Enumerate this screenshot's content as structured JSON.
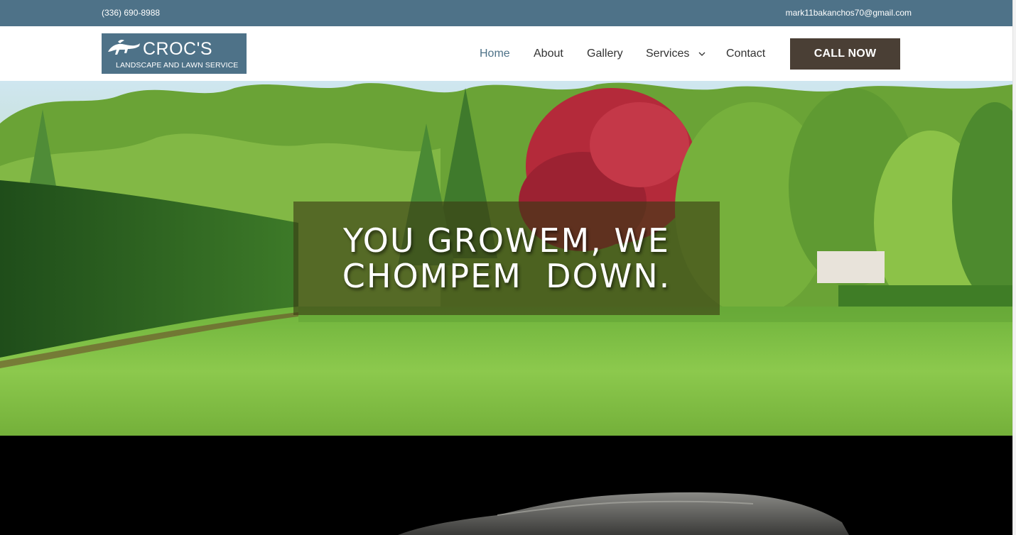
{
  "topbar": {
    "phone": "(336) 690-8988",
    "email": "mark11bakanchos70@gmail.com"
  },
  "header": {
    "logo": {
      "brand": "CROC'S",
      "tagline": "LANDSCAPE AND LAWN SERVICE",
      "icon": "crocodile-icon"
    },
    "nav": {
      "items": [
        {
          "label": "Home",
          "active": true
        },
        {
          "label": "About",
          "active": false
        },
        {
          "label": "Gallery",
          "active": false
        },
        {
          "label": "Services",
          "active": false,
          "has_dropdown": true
        },
        {
          "label": "Contact",
          "active": false
        }
      ],
      "cta_label": "CALL NOW"
    }
  },
  "hero": {
    "headline_line1": "YOU GROWEM, WE",
    "headline_line2": "CHOMPEM  DOWN."
  },
  "colors": {
    "brand_blue": "#4e7288",
    "cta_brown": "#4a3f35",
    "nav_text": "#333333"
  }
}
